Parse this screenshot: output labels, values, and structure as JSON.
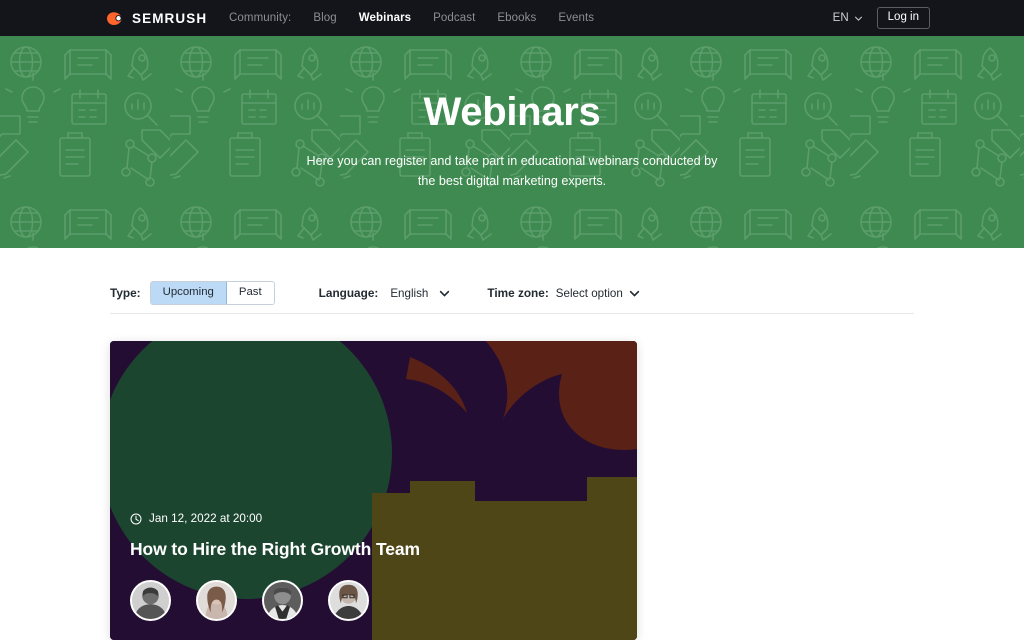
{
  "topbar": {
    "logo_text": "SEMRUSH",
    "logo_icon": "semrush-flame-icon",
    "nav_label": "Community:",
    "nav_items": [
      {
        "label": "Blog",
        "active": false
      },
      {
        "label": "Webinars",
        "active": true
      },
      {
        "label": "Podcast",
        "active": false
      },
      {
        "label": "Ebooks",
        "active": false
      },
      {
        "label": "Events",
        "active": false
      }
    ],
    "language": "EN",
    "language_chevron": "chevron-down-icon",
    "login_label": "Log in"
  },
  "hero": {
    "title": "Webinars",
    "subtitle": "Here you can register and take part in educational webinars conducted by the best digital marketing experts.",
    "background_color": "#3e8a50"
  },
  "filters": {
    "type": {
      "label": "Type:",
      "options": [
        "Upcoming",
        "Past"
      ],
      "selected": "Upcoming"
    },
    "language": {
      "label": "Language:",
      "value": "English",
      "chevron": "chevron-down-icon"
    },
    "timezone": {
      "label": "Time zone:",
      "value": "Select option",
      "placeholder": "Select option",
      "chevron": "chevron-down-icon"
    }
  },
  "webinars": [
    {
      "date": "Jan 12, 2022 at 20:00",
      "date_icon": "clock-icon",
      "title": "How to Hire the Right Growth Team",
      "speaker_count": 4,
      "colors": {
        "background": "#240d33",
        "circle": "#1c452f",
        "flame": "#5a2117",
        "blocks": "#4e4617"
      }
    }
  ]
}
